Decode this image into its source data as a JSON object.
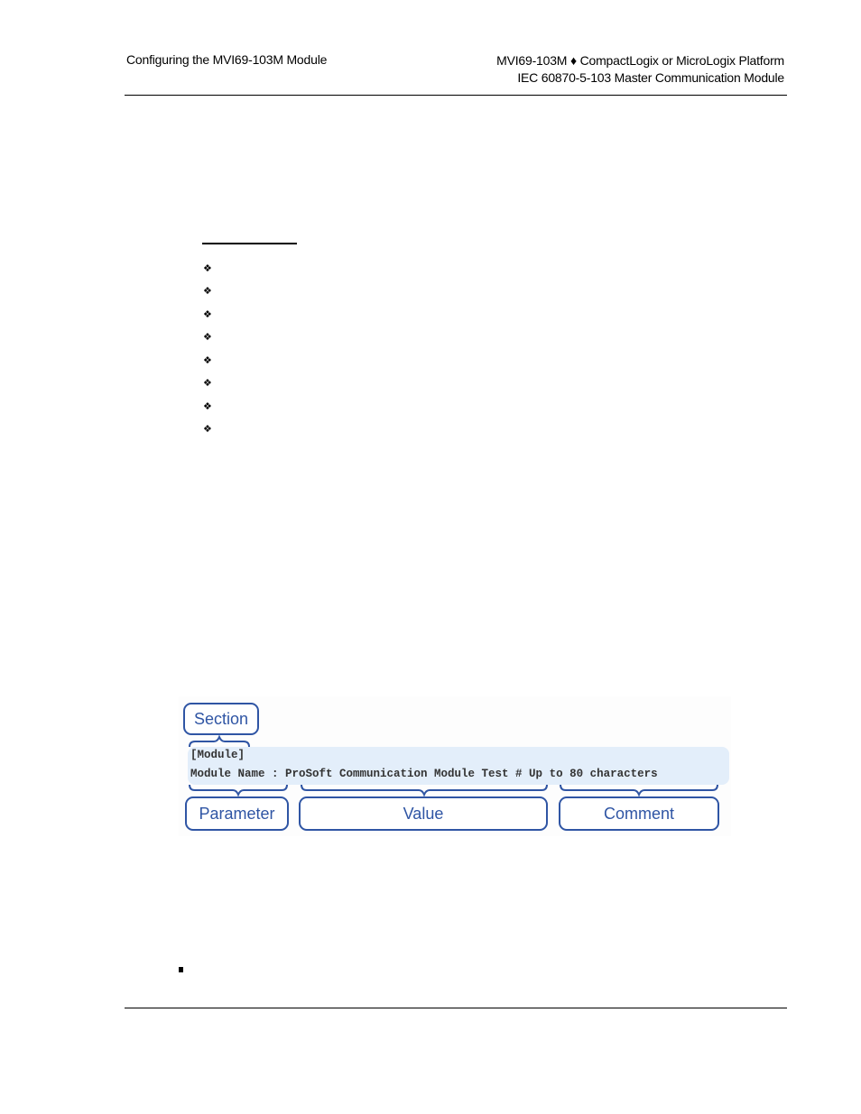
{
  "header": {
    "left": "Configuring the MVI69-103M Module",
    "right_line1": "MVI69-103M ♦ CompactLogix or MicroLogix Platform",
    "right_line2": "IEC 60870-5-103 Master Communication Module"
  },
  "bullets": {
    "glyph": "❖",
    "count": 8
  },
  "diagram": {
    "labels": {
      "section": "Section",
      "parameter": "Parameter",
      "value": "Value",
      "comment": "Comment"
    },
    "code_line1": "[Module]",
    "code_line2": "Module Name : ProSoft Communication Module Test # Up to 80 characters",
    "colors": {
      "accent": "#2f55a4",
      "band": "#e3eefa"
    }
  },
  "footer_bullet": "▪"
}
